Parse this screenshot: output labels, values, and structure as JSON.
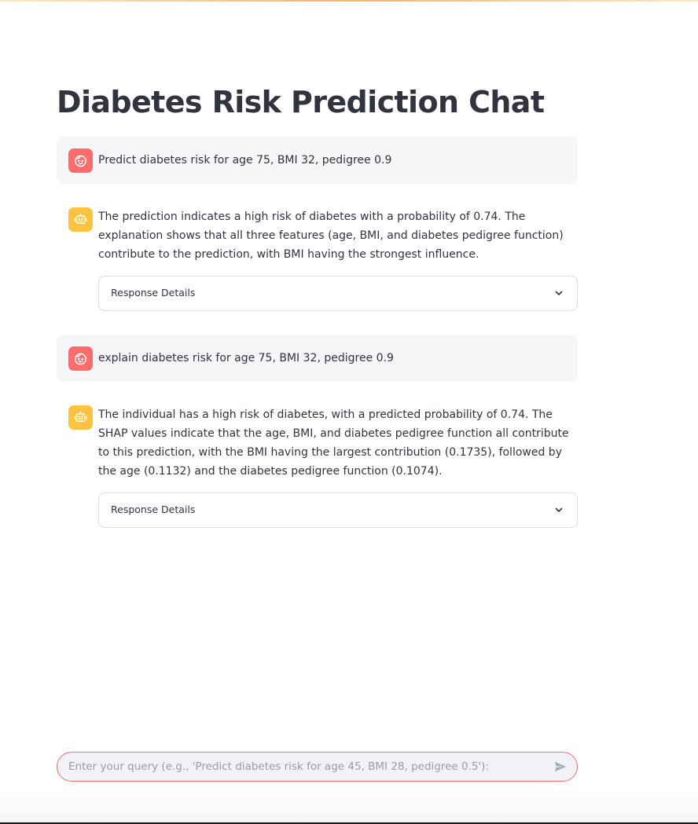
{
  "page": {
    "title": "Diabetes Risk Prediction Chat"
  },
  "messages": [
    {
      "role": "user",
      "avatar_icon": "user-face-icon",
      "text": "Predict diabetes risk for age 75, BMI 32, pedigree 0.9"
    },
    {
      "role": "assistant",
      "avatar_icon": "robot-icon",
      "text": "The prediction indicates a high risk of diabetes with a probability of 0.74. The explanation shows that all three features (age, BMI, and diabetes pedigree function) contribute to the prediction, with BMI having the strongest influence.",
      "expander_label": "Response Details"
    },
    {
      "role": "user",
      "avatar_icon": "user-face-icon",
      "text": "explain diabetes risk for age 75, BMI 32, pedigree 0.9"
    },
    {
      "role": "assistant",
      "avatar_icon": "robot-icon",
      "text": "The individual has a high risk of diabetes, with a predicted probability of 0.74. The SHAP values indicate that the age, BMI, and diabetes pedigree function all contribute to this prediction, with the BMI having the largest contribution (0.1735), followed by the age (0.1132) and the diabetes pedigree function (0.1074).",
      "expander_label": "Response Details"
    }
  ],
  "chat_input": {
    "value": "",
    "placeholder": "Enter your query (e.g., 'Predict diabetes risk for age 45, BMI 28, pedigree 0.5'):",
    "send_icon": "send-icon"
  },
  "colors": {
    "user_avatar": "#ff6b6b",
    "assistant_avatar": "#ffc23d",
    "input_border": "#ff6b6b",
    "text": "#31333f"
  }
}
